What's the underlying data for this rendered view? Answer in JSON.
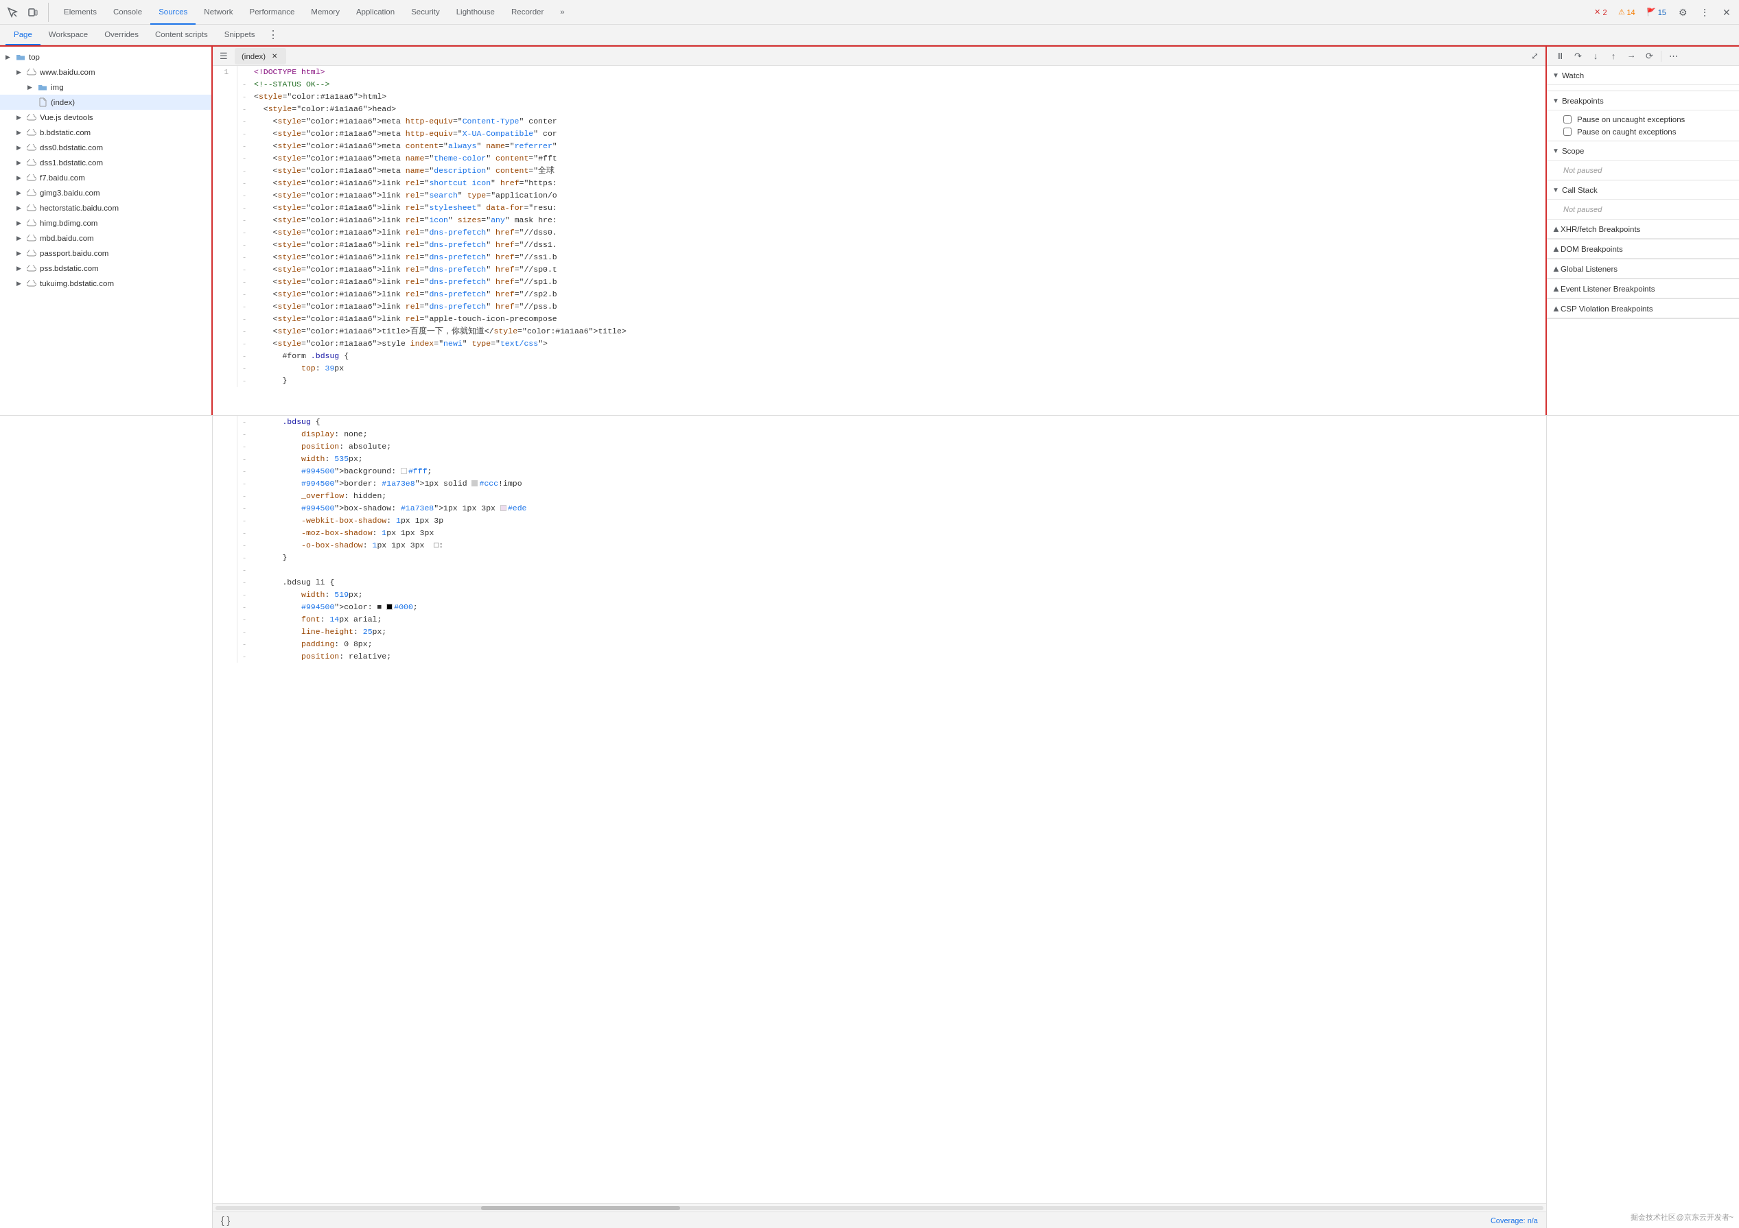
{
  "toolbar": {
    "tabs": [
      {
        "label": "Elements",
        "active": false
      },
      {
        "label": "Console",
        "active": false
      },
      {
        "label": "Sources",
        "active": true
      },
      {
        "label": "Network",
        "active": false
      },
      {
        "label": "Performance",
        "active": false
      },
      {
        "label": "Memory",
        "active": false
      },
      {
        "label": "Application",
        "active": false
      },
      {
        "label": "Security",
        "active": false
      },
      {
        "label": "Lighthouse",
        "active": false
      },
      {
        "label": "Recorder",
        "active": false
      }
    ],
    "more_label": "»",
    "errors": "2",
    "warnings": "14",
    "info": "15"
  },
  "sources_sub_tabs": [
    {
      "label": "Page",
      "active": true
    },
    {
      "label": "Workspace",
      "active": false
    },
    {
      "label": "Overrides",
      "active": false
    },
    {
      "label": "Content scripts",
      "active": false
    },
    {
      "label": "Snippets",
      "active": false
    }
  ],
  "file_tree": {
    "items": [
      {
        "indent": 0,
        "arrow": "▶",
        "icon": "folder",
        "label": "top",
        "type": "folder",
        "expanded": true
      },
      {
        "indent": 1,
        "arrow": "▶",
        "icon": "cloud",
        "label": "www.baidu.com",
        "type": "cloud",
        "expanded": true
      },
      {
        "indent": 2,
        "arrow": "▶",
        "icon": "folder-blue",
        "label": "img",
        "type": "folder"
      },
      {
        "indent": 2,
        "arrow": " ",
        "icon": "file",
        "label": "(index)",
        "type": "file",
        "selected": true
      },
      {
        "indent": 1,
        "arrow": "▶",
        "icon": "cloud",
        "label": "Vue.js devtools",
        "type": "cloud"
      },
      {
        "indent": 1,
        "arrow": "▶",
        "icon": "cloud",
        "label": "b.bdstatic.com",
        "type": "cloud"
      },
      {
        "indent": 1,
        "arrow": "▶",
        "icon": "cloud",
        "label": "dss0.bdstatic.com",
        "type": "cloud"
      },
      {
        "indent": 1,
        "arrow": "▶",
        "icon": "cloud",
        "label": "dss1.bdstatic.com",
        "type": "cloud"
      },
      {
        "indent": 1,
        "arrow": "▶",
        "icon": "cloud",
        "label": "f7.baidu.com",
        "type": "cloud"
      },
      {
        "indent": 1,
        "arrow": "▶",
        "icon": "cloud",
        "label": "gimg3.baidu.com",
        "type": "cloud"
      },
      {
        "indent": 1,
        "arrow": "▶",
        "icon": "cloud",
        "label": "hectorstatic.baidu.com",
        "type": "cloud"
      },
      {
        "indent": 1,
        "arrow": "▶",
        "icon": "cloud",
        "label": "himg.bdimg.com",
        "type": "cloud"
      },
      {
        "indent": 1,
        "arrow": "▶",
        "icon": "cloud",
        "label": "mbd.baidu.com",
        "type": "cloud"
      },
      {
        "indent": 1,
        "arrow": "▶",
        "icon": "cloud",
        "label": "passport.baidu.com",
        "type": "cloud"
      },
      {
        "indent": 1,
        "arrow": "▶",
        "icon": "cloud",
        "label": "pss.bdstatic.com",
        "type": "cloud"
      },
      {
        "indent": 1,
        "arrow": "▶",
        "icon": "cloud",
        "label": "tukuimg.bdstatic.com",
        "type": "cloud"
      }
    ]
  },
  "editor": {
    "filename": "(index)",
    "lines_top": [
      {
        "num": "1",
        "dash": " ",
        "content_raw": "<!DOCTYPE html>",
        "type": "doctype"
      },
      {
        "num": " ",
        "dash": "-",
        "content_raw": "<!--STATUS OK-->",
        "type": "comment"
      },
      {
        "num": " ",
        "dash": "-",
        "content_raw": "<html>",
        "type": "tag"
      },
      {
        "num": " ",
        "dash": "-",
        "content_raw": "  <head>",
        "type": "tag"
      },
      {
        "num": " ",
        "dash": "-",
        "content_raw": "    <meta http-equiv=\"Content-Type\" conter",
        "type": "code"
      },
      {
        "num": " ",
        "dash": "-",
        "content_raw": "    <meta http-equiv=\"X-UA-Compatible\" cor",
        "type": "code"
      },
      {
        "num": " ",
        "dash": "-",
        "content_raw": "    <meta content=\"always\" name=\"referrer\"",
        "type": "code"
      },
      {
        "num": " ",
        "dash": "-",
        "content_raw": "    <meta name=\"theme-color\" content=\"#fft",
        "type": "code"
      },
      {
        "num": " ",
        "dash": "-",
        "content_raw": "    <meta name=\"description\" content=\"全球",
        "type": "code"
      },
      {
        "num": " ",
        "dash": "-",
        "content_raw": "    <link rel=\"shortcut icon\" href=\"https:",
        "type": "code"
      },
      {
        "num": " ",
        "dash": "-",
        "content_raw": "    <link rel=\"search\" type=\"application/o",
        "type": "code"
      },
      {
        "num": " ",
        "dash": "-",
        "content_raw": "    <link rel=\"stylesheet\" data-for=\"resu:",
        "type": "code"
      },
      {
        "num": " ",
        "dash": "-",
        "content_raw": "    <link rel=\"icon\" sizes=\"any\" mask hre:",
        "type": "code"
      },
      {
        "num": " ",
        "dash": "-",
        "content_raw": "    <link rel=\"dns-prefetch\" href=\"//dss0.",
        "type": "code"
      },
      {
        "num": " ",
        "dash": "-",
        "content_raw": "    <link rel=\"dns-prefetch\" href=\"//dss1.",
        "type": "code"
      },
      {
        "num": " ",
        "dash": "-",
        "content_raw": "    <link rel=\"dns-prefetch\" href=\"//ss1.b",
        "type": "code"
      },
      {
        "num": " ",
        "dash": "-",
        "content_raw": "    <link rel=\"dns-prefetch\" href=\"//sp0.t",
        "type": "code"
      },
      {
        "num": " ",
        "dash": "-",
        "content_raw": "    <link rel=\"dns-prefetch\" href=\"//sp1.b",
        "type": "code"
      },
      {
        "num": " ",
        "dash": "-",
        "content_raw": "    <link rel=\"dns-prefetch\" href=\"//sp2.b",
        "type": "code"
      },
      {
        "num": " ",
        "dash": "-",
        "content_raw": "    <link rel=\"dns-prefetch\" href=\"//pss.b",
        "type": "code"
      },
      {
        "num": " ",
        "dash": "-",
        "content_raw": "    <link rel=\"apple-touch-icon-precompose",
        "type": "code"
      },
      {
        "num": " ",
        "dash": "-",
        "content_raw": "    <title>百度一下，你就知道</title>",
        "type": "code"
      },
      {
        "num": " ",
        "dash": "-",
        "content_raw": "    <style index=\"newi\" type=\"text/css\">",
        "type": "code"
      },
      {
        "num": " ",
        "dash": "-",
        "content_raw": "      #form .bdsug {",
        "type": "css"
      },
      {
        "num": " ",
        "dash": "-",
        "content_raw": "          top: 39px",
        "type": "css"
      },
      {
        "num": " ",
        "dash": "-",
        "content_raw": "      }",
        "type": "css"
      }
    ],
    "lines_bottom": [
      {
        "num": " ",
        "dash": "-",
        "content_raw": "      .bdsug {",
        "type": "css"
      },
      {
        "num": " ",
        "dash": "-",
        "content_raw": "          display: none;",
        "type": "css"
      },
      {
        "num": " ",
        "dash": "-",
        "content_raw": "          position: absolute;",
        "type": "css"
      },
      {
        "num": " ",
        "dash": "-",
        "content_raw": "          width: 535px;",
        "type": "css"
      },
      {
        "num": " ",
        "dash": "-",
        "content_raw": "          background: #fff;",
        "type": "css_color",
        "color": "#fff"
      },
      {
        "num": " ",
        "dash": "-",
        "content_raw": "          border: 1px solid #ccc!impo",
        "type": "css_color",
        "color": "#ccc"
      },
      {
        "num": " ",
        "dash": "-",
        "content_raw": "          _overflow: hidden;",
        "type": "css"
      },
      {
        "num": " ",
        "dash": "-",
        "content_raw": "          box-shadow: 1px 1px 3px #ede",
        "type": "css_color",
        "color": "#ede"
      },
      {
        "num": " ",
        "dash": "-",
        "content_raw": "          -webkit-box-shadow: 1px 1px 3p",
        "type": "css"
      },
      {
        "num": " ",
        "dash": "-",
        "content_raw": "          -moz-box-shadow: 1px 1px 3px",
        "type": "css"
      },
      {
        "num": " ",
        "dash": "-",
        "content_raw": "          -o-box-shadow: 1px 1px 3px  □:",
        "type": "css"
      },
      {
        "num": " ",
        "dash": "-",
        "content_raw": "      }",
        "type": "css"
      },
      {
        "num": " ",
        "dash": "-",
        "content_raw": "",
        "type": "empty"
      },
      {
        "num": " ",
        "dash": "-",
        "content_raw": "      .bdsug li {",
        "type": "css"
      },
      {
        "num": " ",
        "dash": "-",
        "content_raw": "          width: 519px;",
        "type": "css"
      },
      {
        "num": " ",
        "dash": "-",
        "content_raw": "          color: ■ #000;",
        "type": "css_color",
        "color": "#000"
      },
      {
        "num": " ",
        "dash": "-",
        "content_raw": "          font: 14px arial;",
        "type": "css"
      },
      {
        "num": " ",
        "dash": "-",
        "content_raw": "          line-height: 25px;",
        "type": "css"
      },
      {
        "num": " ",
        "dash": "-",
        "content_raw": "          padding: 0 8px;",
        "type": "css"
      },
      {
        "num": " ",
        "dash": "-",
        "content_raw": "          position: relative;",
        "type": "css"
      }
    ],
    "footer": {
      "pretty_print": "{ }",
      "coverage": "Coverage: n/a"
    }
  },
  "right_panel": {
    "debugger_btns": [
      "⏺",
      "⏭",
      "⬇",
      "⬆",
      "↩",
      "⟳"
    ],
    "sections": [
      {
        "id": "watch",
        "label": "Watch",
        "expanded": true,
        "content_type": "empty"
      },
      {
        "id": "breakpoints",
        "label": "Breakpoints",
        "expanded": true,
        "content_type": "checkboxes",
        "items": [
          {
            "label": "Pause on uncaught exceptions",
            "checked": false
          },
          {
            "label": "Pause on caught exceptions",
            "checked": false
          }
        ]
      },
      {
        "id": "scope",
        "label": "Scope",
        "expanded": true,
        "content_type": "not_paused",
        "text": "Not paused"
      },
      {
        "id": "call_stack",
        "label": "Call Stack",
        "expanded": true,
        "content_type": "not_paused",
        "text": "Not paused"
      },
      {
        "id": "xhr",
        "label": "XHR/fetch Breakpoints",
        "expanded": false
      },
      {
        "id": "dom",
        "label": "DOM Breakpoints",
        "expanded": false
      },
      {
        "id": "listeners",
        "label": "Global Listeners",
        "expanded": false
      },
      {
        "id": "event_listeners",
        "label": "Event Listener Breakpoints",
        "expanded": false
      },
      {
        "id": "csp",
        "label": "CSP Violation Breakpoints",
        "expanded": false
      }
    ]
  },
  "watermark": {
    "text": "掘金技术社区@京东云开发者~"
  },
  "colors": {
    "red_border": "#d32f2f",
    "blue_accent": "#1a73e8"
  }
}
